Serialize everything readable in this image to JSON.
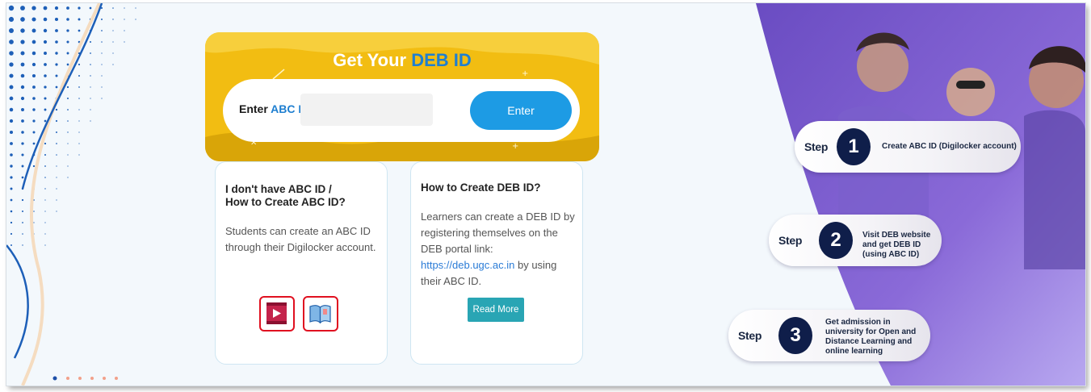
{
  "hero": {
    "title_prefix": "Get Your ",
    "title_accent": "DEB ID",
    "label_prefix": "Enter ",
    "label_accent": "ABC ID:",
    "input_value": "",
    "button_label": "Enter"
  },
  "card_abc": {
    "title_line1": "I don't have ABC ID /",
    "title_line2": "How to Create ABC ID?",
    "body": "Students can create an ABC ID through their Digilocker account.",
    "icons": [
      "video-play-icon",
      "book-icon"
    ]
  },
  "card_deb": {
    "title": "How to Create DEB ID?",
    "body_before": "Learners can create a DEB ID by registering themselves on the DEB portal link: ",
    "link_text": "https://deb.ugc.ac.in",
    "body_after": " by using their ABC ID.",
    "button_label": "Read More"
  },
  "steps": [
    {
      "word": "Step",
      "number": "1",
      "text": "Create ABC ID (Digilocker account)"
    },
    {
      "word": "Step",
      "number": "2",
      "text": "Visit DEB website and get DEB ID (using ABC ID)"
    },
    {
      "word": "Step",
      "number": "3",
      "text": "Get admission in university for Open and Distance Learning and online learning"
    }
  ],
  "colors": {
    "hero_bg": "#f2bd12",
    "accent_blue": "#1f7fd0",
    "enter_button": "#1d9be4",
    "read_more_button": "#29a5b4",
    "step_circle": "#0f1e4a",
    "icon_highlight": "#e01020"
  }
}
